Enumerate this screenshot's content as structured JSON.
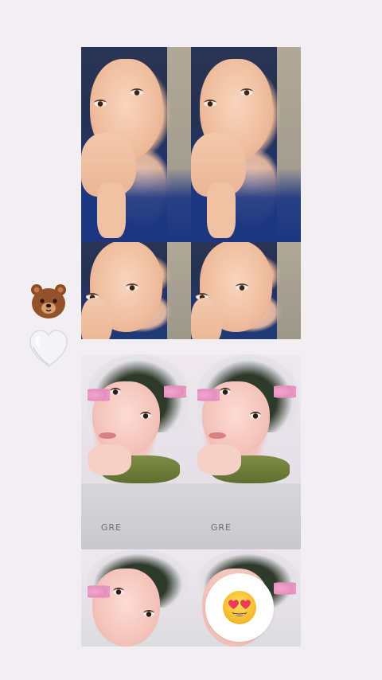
{
  "stickers": {
    "bear": "bear-sticker-icon",
    "heart": "white-heart-icon"
  },
  "photo_strips": [
    {
      "name": "portrait-strip-dark-hijab",
      "cells": 4
    },
    {
      "name": "portrait-strip-green-hijab",
      "cells": 4
    }
  ],
  "shirt_print": "GRE",
  "reaction": {
    "icon": "heart-eyes-emoji-icon",
    "label": "😍"
  },
  "colors": {
    "background": "#f1eff1",
    "reaction_bubble": "#ffffff",
    "bear_brown": "#8a4a24",
    "heart_white": "#f5f5f7",
    "emoji_yellow": "#f7c531",
    "emoji_heart": "#ee3a57"
  }
}
